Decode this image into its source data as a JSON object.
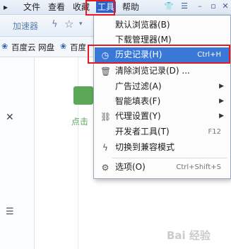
{
  "menubar": {
    "items": [
      "文件",
      "查看",
      "收藏",
      "工具",
      "帮助"
    ],
    "active_index": 3
  },
  "toolbar": {
    "accelerator_label": "加速器"
  },
  "bookmarks": {
    "items": [
      "百度云 网盘",
      "百度"
    ]
  },
  "content": {
    "click_hint": "点击"
  },
  "tools_menu": {
    "items": [
      {
        "label": "默认浏览器(B)"
      },
      {
        "label": "下载管理器(M)"
      },
      {
        "label": "历史记录(H)",
        "shortcut": "Ctrl+H"
      },
      {
        "label": "清除浏览记录(D) ..."
      },
      {
        "label": "广告过滤(A)"
      },
      {
        "label": "智能填表(F)"
      },
      {
        "label": "代理设置(Y)"
      },
      {
        "label": "开发者工具(T)",
        "shortcut": "F12"
      },
      {
        "label": "切换到兼容模式"
      },
      {
        "label": "选项(O)",
        "shortcut": "Ctrl+Shift+S"
      }
    ]
  },
  "watermark": {
    "text": "Bai 经验"
  },
  "colors": {
    "highlight": "#3a78d8",
    "menu_active": "#2f62c9",
    "annotation": "#e11b22"
  }
}
